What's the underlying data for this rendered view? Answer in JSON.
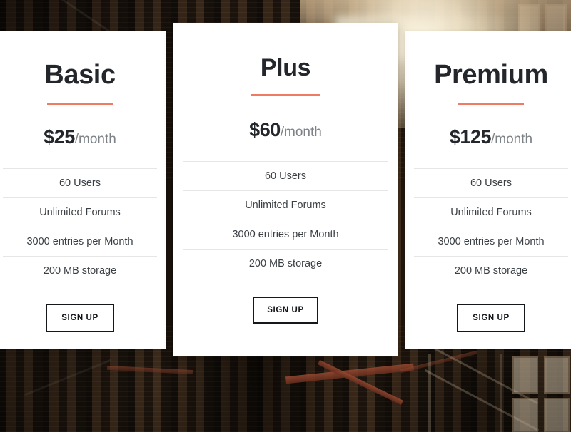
{
  "theme": {
    "accent_color": "#ef7b62",
    "card_background": "#ffffff",
    "heading_color": "#23272b",
    "feature_text_color": "#3a3f44",
    "period_color": "#7d8287",
    "button_border_color": "#15181b"
  },
  "background": {
    "scene": "urban-alley-brick-fire-escape-photo",
    "has_sun_flare": true
  },
  "plans": [
    {
      "id": "basic",
      "name": "Basic",
      "price": "$25",
      "period": "/month",
      "features": [
        "60 Users",
        "Unlimited Forums",
        "3000 entries per Month",
        "200 MB storage"
      ],
      "cta_label": "SIGN UP",
      "featured": false
    },
    {
      "id": "plus",
      "name": "Plus",
      "price": "$60",
      "period": "/month",
      "features": [
        "60 Users",
        "Unlimited Forums",
        "3000 entries per Month",
        "200 MB storage"
      ],
      "cta_label": "SIGN UP",
      "featured": true
    },
    {
      "id": "premium",
      "name": "Premium",
      "price": "$125",
      "period": "/month",
      "features": [
        "60 Users",
        "Unlimited Forums",
        "3000 entries per Month",
        "200 MB storage"
      ],
      "cta_label": "SIGN UP",
      "featured": false
    }
  ]
}
